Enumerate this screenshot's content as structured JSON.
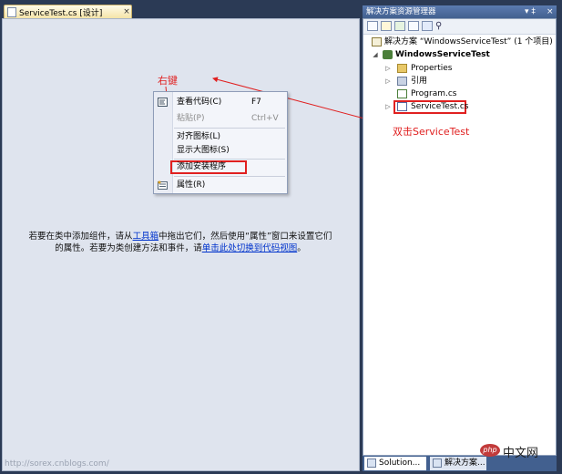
{
  "document": {
    "tab_label": "ServiceTest.cs [设计]",
    "tab_close": "×",
    "info_line1_a": "若要在类中添加组件，请从",
    "info_link1": "工具箱",
    "info_line1_b": "中拖出它们，然后使用“属性”窗口来设置它们",
    "info_line2_a": "的属性。若要为类创建方法和事件，请",
    "info_link2": "单击此处切换到代码视图",
    "info_line2_b": "。"
  },
  "context_menu": {
    "items": [
      {
        "label": "查看代码(C)",
        "shortcut": "F7",
        "icon": "view-code-icon"
      },
      {
        "label": "粘贴(P)",
        "shortcut": "Ctrl+V",
        "disabled": true
      },
      {
        "label": "对齐图标(L)"
      },
      {
        "label": "显示大图标(S)"
      },
      {
        "label": "添加安装程序"
      },
      {
        "label": "属性(R)",
        "icon": "properties-icon"
      }
    ]
  },
  "annotations": {
    "right_click": "右键",
    "double_click": "双击ServiceTest"
  },
  "solution_explorer": {
    "title": "解决方案资源管理器",
    "pin": "▾ ‡",
    "close": "×",
    "toolbar_icons": [
      "properties-icon",
      "show-all-files-icon",
      "refresh-icon",
      "view-code-icon",
      "view-designer-icon",
      "class-diagram-icon"
    ],
    "tree": [
      {
        "label": "解决方案 “WindowsServiceTest” (1 个项目)",
        "icon": "solution-icon"
      },
      {
        "label": "WindowsServiceTest",
        "icon": "csharp-project-icon",
        "bold": true,
        "expanded": true
      },
      {
        "label": "Properties",
        "icon": "properties-folder-icon",
        "collapsed": true
      },
      {
        "label": "引用",
        "icon": "references-icon",
        "collapsed": true
      },
      {
        "label": "Program.cs",
        "icon": "csharp-file-icon"
      },
      {
        "label": "ServiceTest.cs",
        "icon": "service-file-icon",
        "collapsed": true,
        "highlighted": true
      }
    ],
    "bottom_tabs": [
      {
        "label": "Solution...",
        "icon": "solution-tab-icon"
      },
      {
        "label": "解决方案...",
        "icon": "solution-tab-icon"
      }
    ]
  },
  "watermark": "http://sorex.cnblogs.com/",
  "logo": {
    "text": "中文网",
    "mark": "php"
  },
  "colors": {
    "annotation": "#e02020",
    "accent": "#42608f",
    "link": "#0033cc"
  }
}
